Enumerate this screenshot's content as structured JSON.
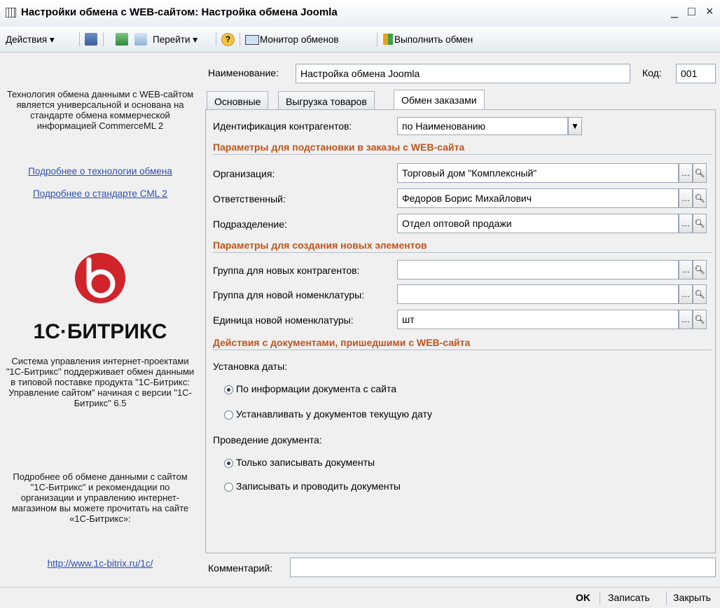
{
  "window": {
    "title": "Настройки обмена с WEB-сайтом: Настройка обмена Joomla",
    "min": "_",
    "max": "□",
    "close": "×"
  },
  "toolbar": {
    "actions": "Действия ▾",
    "goto": "Перейти ▾",
    "help": "?",
    "monitor": "Монитор обменов",
    "execute": "Выполнить обмен"
  },
  "left": {
    "intro": "Технология обмена данными с WEB-сайтом является универсальной и основана на стандарте обмена коммерческой информацией CommerceML 2",
    "link_tech": "Подробнее о технологии обмена",
    "link_cml": "Подробнее о стандарте CML 2",
    "brand": "1С·БИТРИКС",
    "system": "Система управления интернет-проектами \"1С-Битрикс\" поддерживает обмен данными в типовой поставке продукта \"1С-Битрикс: Управление сайтом\" начиная с версии \"1С-Битрикс\" 6.5",
    "more": "Подробнее об обмене данными с сайтом \"1С-Битрикс\" и рекомендации по организации и управлению интернет-магазином вы можете прочитать на сайте «1С-Битрикс»:",
    "url": "http://www.1c-bitrix.ru/1c/"
  },
  "header": {
    "name_label": "Наименование:",
    "name_value": "Настройка обмена Joomla",
    "code_label": "Код:",
    "code_value": "001"
  },
  "tabs": [
    "Основные",
    "Выгрузка товаров",
    "Обмен заказами"
  ],
  "form": {
    "id_label": "Идентификация контрагентов:",
    "id_value": "по Наименованию",
    "section1": "Параметры для подстановки в заказы с WEB-сайта",
    "org_label": "Организация:",
    "org_value": "Торговый дом \"Комплексный\"",
    "resp_label": "Ответственный:",
    "resp_value": "Федоров Борис Михайлович",
    "dept_label": "Подразделение:",
    "dept_value": "Отдел оптовой продажи",
    "section2": "Параметры для создания новых элементов",
    "grp_contr_label": "Группа для новых контрагентов:",
    "grp_contr_value": "",
    "grp_nom_label": "Группа для новой номенклатуры:",
    "grp_nom_value": "",
    "unit_label": "Единица новой номенклатуры:",
    "unit_value": "шт",
    "section3": "Действия с документами, пришедшими с WEB-сайта",
    "date_label": "Установка даты:",
    "date_opt1": "По информации документа с сайта",
    "date_opt2": "Устанавливать у документов текущую дату",
    "post_label": "Проведение документа:",
    "post_opt1": "Только записывать документы",
    "post_opt2": "Записывать и проводить документы"
  },
  "comment_label": "Комментарий:",
  "comment_value": "",
  "status": {
    "ok": "OK",
    "save": "Записать",
    "close": "Закрыть"
  }
}
